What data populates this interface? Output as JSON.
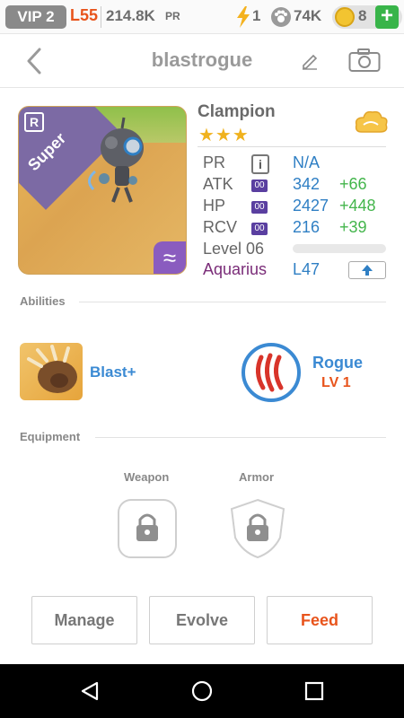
{
  "status_bar": {
    "vip": "VIP 2",
    "level": "L55",
    "pr_value": "214.8K",
    "pr_label": "PR",
    "energy": "1",
    "food": "74K",
    "coins": "8",
    "add_label": "+"
  },
  "header": {
    "title": "blastrogue"
  },
  "monster": {
    "name": "Clampion",
    "rarity": "Super",
    "rarity_badge": "R",
    "element_symbol": "≈",
    "stars": "★★★",
    "stats": [
      {
        "label": "PR",
        "value": "N/A",
        "bonus": ""
      },
      {
        "label": "ATK",
        "value": "342",
        "bonus": "+66",
        "chip": "00"
      },
      {
        "label": "HP",
        "value": "2427",
        "bonus": "+448",
        "chip": "00"
      },
      {
        "label": "RCV",
        "value": "216",
        "bonus": "+39",
        "chip": "00"
      }
    ],
    "level_label": "Level 06",
    "xp_progress": 0,
    "sign": "Aquarius",
    "sign_level": "L47"
  },
  "abilities": {
    "section_title": "Abilities",
    "ability_name": "Blast+",
    "class_name": "Rogue",
    "class_level": "LV 1"
  },
  "equipment": {
    "section_title": "Equipment",
    "weapon_label": "Weapon",
    "armor_label": "Armor"
  },
  "actions": {
    "manage": "Manage",
    "evolve": "Evolve",
    "feed": "Feed"
  },
  "colors": {
    "accent_blue": "#2f7fc4",
    "bonus_green": "#43b54b",
    "orange": "#e8541c",
    "star_gold": "#f0b21e"
  }
}
